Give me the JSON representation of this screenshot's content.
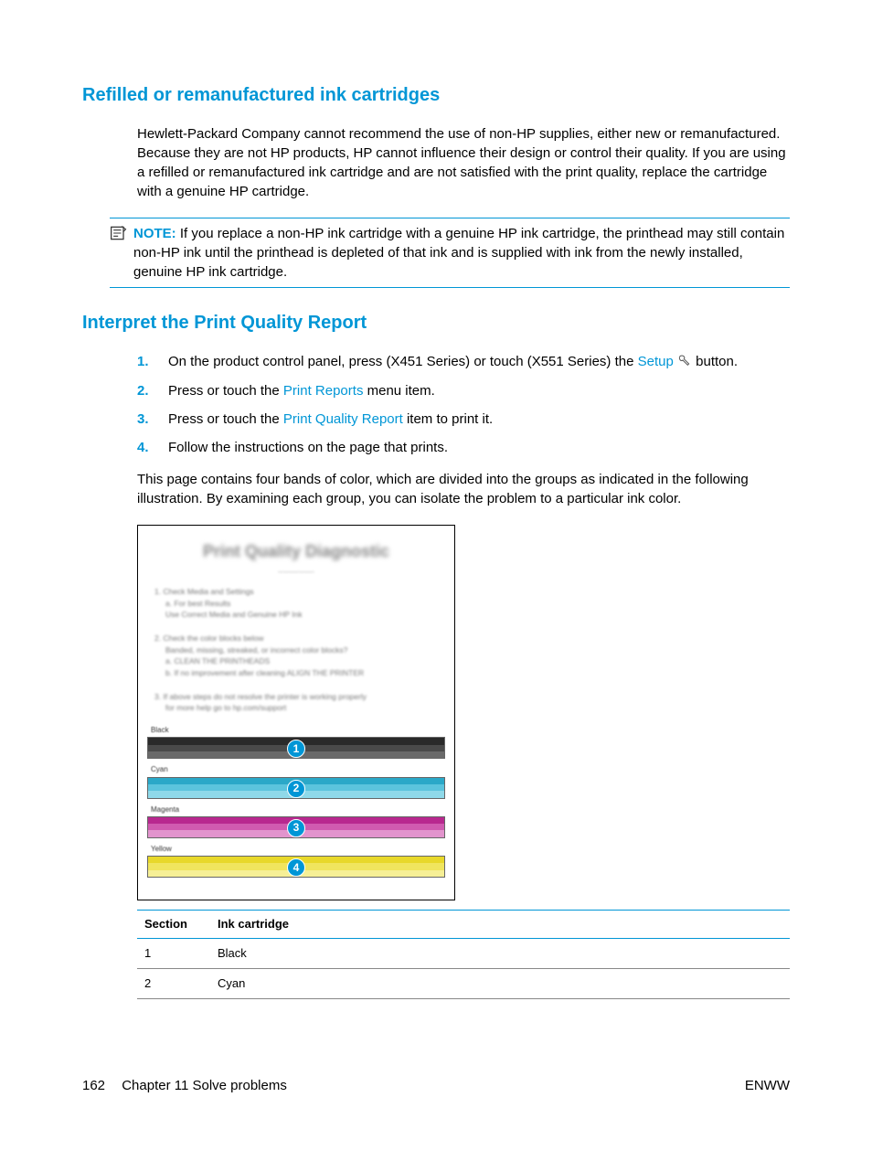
{
  "section1": {
    "heading": "Refilled or remanufactured ink cartridges",
    "paragraph": "Hewlett-Packard Company cannot recommend the use of non-HP supplies, either new or remanufactured. Because they are not HP products, HP cannot influence their design or control their quality. If you are using a refilled or remanufactured ink cartridge and are not satisfied with the print quality, replace the cartridge with a genuine HP cartridge."
  },
  "note": {
    "label": "NOTE:",
    "text": "If you replace a non-HP ink cartridge with a genuine HP ink cartridge, the printhead may still contain non-HP ink until the printhead is depleted of that ink and is supplied with ink from the newly installed, genuine HP ink cartridge."
  },
  "section2": {
    "heading": "Interpret the Print Quality Report",
    "steps": {
      "s1a": "On the product control panel, press (X451 Series) or touch (X551 Series) the ",
      "s1_link": "Setup",
      "s1b": " button.",
      "s2a": "Press or touch the ",
      "s2_link": "Print Reports",
      "s2b": " menu item.",
      "s3a": "Press or touch the ",
      "s3_link": "Print Quality Report",
      "s3b": " item to print it.",
      "s4": "Follow the instructions on the page that prints."
    },
    "nums": {
      "n1": "1.",
      "n2": "2.",
      "n3": "3.",
      "n4": "4."
    },
    "paragraph": "This page contains four bands of color, which are divided into the groups as indicated in the following illustration. By examining each group, you can isolate the problem to a particular ink color."
  },
  "diagram": {
    "title": "Print Quality Diagnostic",
    "labels": {
      "black": "Black",
      "cyan": "Cyan",
      "magenta": "Magenta",
      "yellow": "Yellow"
    },
    "callouts": {
      "c1": "1",
      "c2": "2",
      "c3": "3",
      "c4": "4"
    }
  },
  "table": {
    "headers": {
      "h1": "Section",
      "h2": "Ink cartridge"
    },
    "rows": [
      {
        "c1": "1",
        "c2": "Black"
      },
      {
        "c1": "2",
        "c2": "Cyan"
      }
    ]
  },
  "footer": {
    "page": "162",
    "chapter": "Chapter 11   Solve problems",
    "right": "ENWW"
  }
}
